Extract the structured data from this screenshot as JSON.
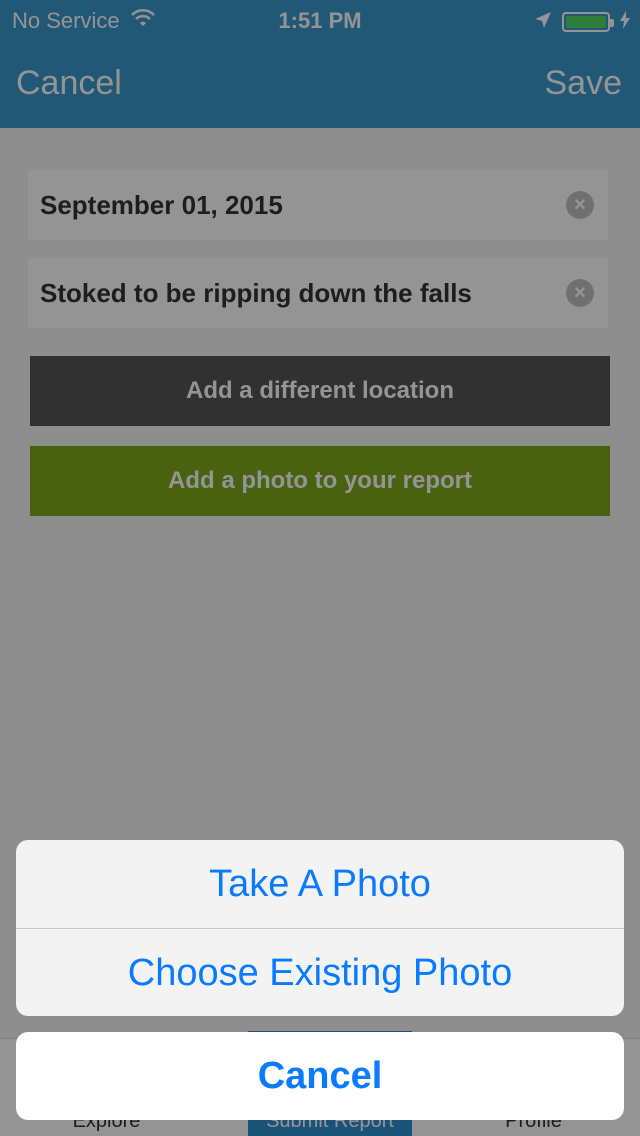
{
  "status_bar": {
    "carrier": "No Service",
    "time": "1:51 PM",
    "battery_level": 1.0
  },
  "nav": {
    "cancel_label": "Cancel",
    "save_label": "Save"
  },
  "form": {
    "date_value": "September 01, 2015",
    "description_value": "Stoked to be ripping down the falls",
    "location_button": "Add a different location",
    "photo_button": "Add a photo to your report"
  },
  "tabs": [
    {
      "label": "Explore"
    },
    {
      "label": "Submit Report"
    },
    {
      "label": "Profile"
    }
  ],
  "action_sheet": {
    "take_photo": "Take A Photo",
    "choose_existing": "Choose Existing Photo",
    "cancel": "Cancel"
  },
  "colors": {
    "accent": "#3a98cc",
    "photo_button": "#7da91c",
    "location_button": "#555555",
    "ios_blue": "#0a7aff"
  },
  "icons": [
    "wifi-icon",
    "location-arrow-icon",
    "battery-icon",
    "charging-icon",
    "clear-icon"
  ]
}
